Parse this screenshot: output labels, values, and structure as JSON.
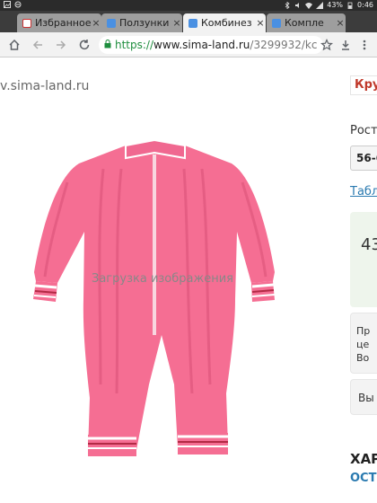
{
  "status_bar": {
    "battery": "43%",
    "time": "0:46"
  },
  "tabs": [
    {
      "title": "Избранное",
      "icon": "mail-icon",
      "active": false
    },
    {
      "title": "Ползунки",
      "icon": "page-icon",
      "active": false
    },
    {
      "title": "Комбинез",
      "icon": "page-icon",
      "active": true
    },
    {
      "title": "Компле",
      "icon": "page-icon",
      "active": false
    }
  ],
  "tab_close_glyph": "×",
  "toolbar": {
    "url_scheme": "https://",
    "url_host": "www.sima-land.ru",
    "url_path": "/3299932/kc"
  },
  "page": {
    "site_url": "v.sima-land.ru",
    "image_loading_text": "Загрузка изображения",
    "red_button": "Кру",
    "rost_label": "Рост",
    "size_value": "56-6",
    "size_table_link": "Табл",
    "price": "43",
    "info_lines": [
      "Пр",
      "це",
      "Во"
    ],
    "vy_button": "Вы",
    "characteristics_heading": "ХАР",
    "ost_link": "ОСТ"
  },
  "colors": {
    "onesie": "#f56e93",
    "onesie_shade": "#e25a80",
    "cuff_white": "#ffffff",
    "cuff_stripe": "#b22a45",
    "accent_red": "#c0392b",
    "link_blue": "#2a7ab0",
    "price_bg": "#eef5ec"
  }
}
